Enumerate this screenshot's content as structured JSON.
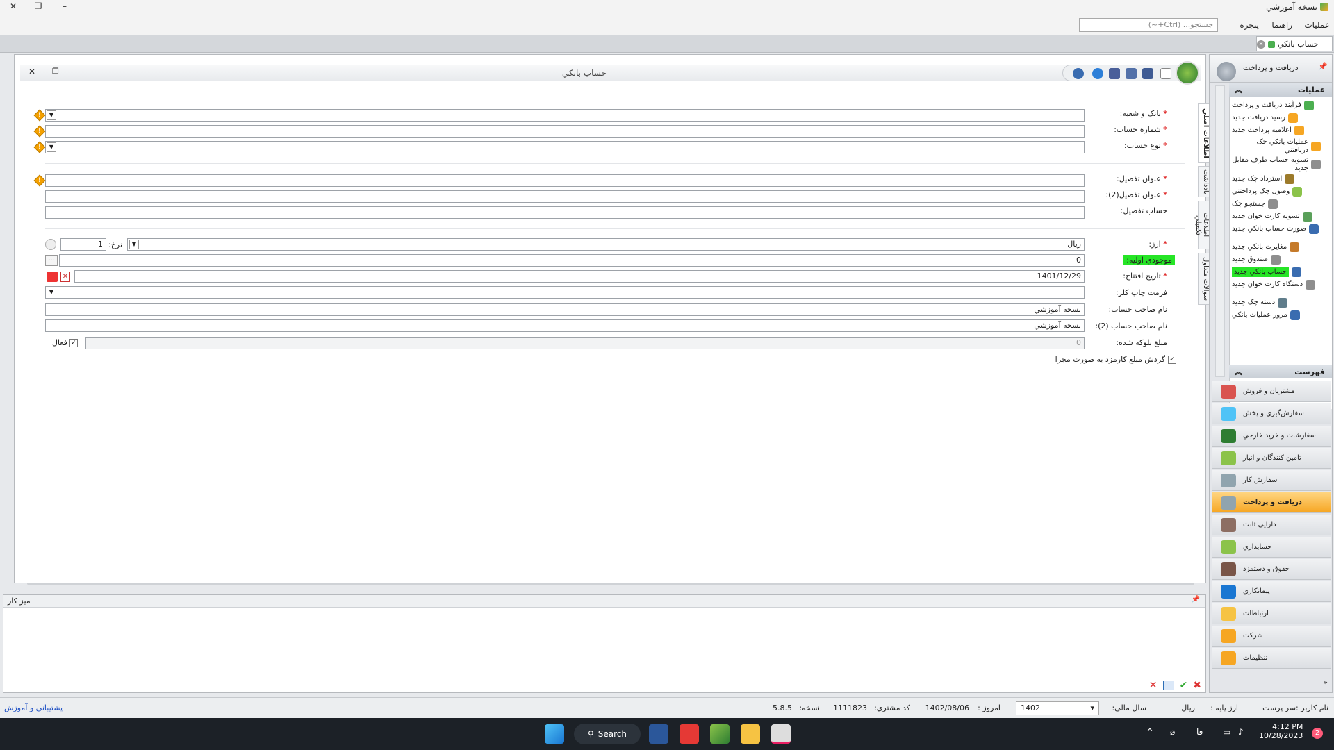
{
  "window": {
    "title": "نسخه آموزشي",
    "min_label": "–",
    "restore_label": "❐",
    "close_label": "✕"
  },
  "menu": {
    "items": [
      "عمليات",
      "راهنما",
      "پنجره"
    ],
    "search_placeholder": "جستجو... (Ctrl+~)"
  },
  "doc_tab": {
    "label": "حساب بانکي",
    "close_label": "✕"
  },
  "form": {
    "title": "حساب بانکي",
    "fields": {
      "bank_branch": "بانک و شعبه:",
      "account_number": "شماره حساب:",
      "account_type": "نوع حساب:",
      "detail_title": "عنوان تفصيل:",
      "detail_title2": "عنوان تفصيل(2):",
      "detail_account": "حساب تفصيل:",
      "currency": "ارز:",
      "currency_value": "ريال",
      "rate_label": "نرخ:",
      "rate_value": "1",
      "opening_balance": "موجودي اوليه:",
      "opening_balance_value": "0",
      "opening_date": "تاريخ افتتاح:",
      "opening_date_value": "1401/12/29",
      "check_print_format": "فرمت چاپ کلر:",
      "owner_name": "نام صاحب حساب:",
      "owner_name_value": "نسخه آموزشي",
      "owner_name2": "نام صاحب حساب (2):",
      "owner_name2_value": "نسخه آموزشي",
      "blocked_amount": "مبلغ بلوکه شده:",
      "blocked_amount_value": "0",
      "active_label": "فعال",
      "rounding_label": "گردش مبلغ کارمزد به صورت مجزا",
      "ellipsis": "..."
    },
    "side_tabs": [
      "اطلاعات اصلي",
      "يادداشت",
      "اطلاعات تکميلي",
      "سوالات متداول"
    ]
  },
  "right_panel": {
    "header": "دريافت و پرداخت",
    "ops_title": "عمليات",
    "ops": [
      "فرآيند دريافت و پرداخت",
      "رسيد دريافت جديد",
      "اعلاميه پرداخت جديد",
      "عمليات بانکي چک دريافتني",
      "تسويه حساب طرف مقابل جديد",
      "استرداد چک جديد",
      "وصول چک پرداختني",
      "جستجو چک",
      "تسويه کارت خوان جديد",
      "صورت حساب بانکي جديد",
      "مغايرت بانکي جديد",
      "صندوق جديد",
      "حساب بانکي جديد",
      "دستگاه کارت خوان جديد",
      "دسته چک جديد",
      "مرور عمليات بانکي"
    ],
    "list_title": "فهرست",
    "nav": [
      "مشتريان و فروش",
      "سفارش‌گيري و پخش",
      "سفارشات و خريد خارجي",
      "تامين کنندگان و انبار",
      "سفارش کار",
      "دريافت و پرداخت",
      "دارايي ثابت",
      "حسابداري",
      "حقوق و دستمزد",
      "پيمانکاري",
      "ارتباطات",
      "شرکت",
      "تنظيمات"
    ]
  },
  "desk": {
    "title": "ميز کار"
  },
  "status": {
    "user": "نام کاربر :سر پرست",
    "base_currency_label": "ارز پايه :",
    "base_currency": "ريال",
    "fiscal_year_label": "سال مالي:",
    "fiscal_year": "1402",
    "today_label": "امروز :",
    "today": "1402/08/06",
    "customer_code_label": "کد مشتري:",
    "customer_code": "1111823",
    "version_label": "نسخه:",
    "version": "5.8.5",
    "support": "پشتيباني و آموزش"
  },
  "taskbar": {
    "search_label": "Search",
    "time": "4:12 PM",
    "date": "10/28/2023",
    "badge": "2",
    "lang": "فا"
  },
  "colors": {
    "accent": "#f6a623",
    "highlight": "#26e526",
    "required": "#e03030",
    "taskbar": "#1c2127"
  }
}
